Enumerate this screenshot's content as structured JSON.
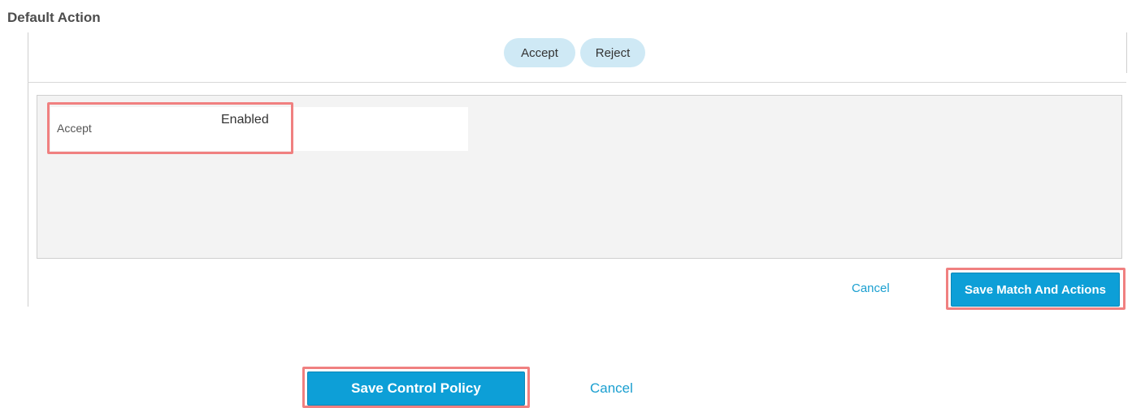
{
  "section": {
    "title": "Default Action"
  },
  "action_toggle": {
    "accept_label": "Accept",
    "reject_label": "Reject"
  },
  "actions": {
    "rows": [
      {
        "name": "Accept",
        "value": "Enabled"
      }
    ]
  },
  "footer_inner": {
    "cancel_label": "Cancel",
    "save_label": "Save Match And Actions"
  },
  "footer_outer": {
    "save_label": "Save Control Policy",
    "cancel_label": "Cancel"
  },
  "colors": {
    "primary": "#0d9fd7",
    "pill": "#cfe9f5",
    "link": "#1a9fd0",
    "highlight": "#f08080"
  }
}
